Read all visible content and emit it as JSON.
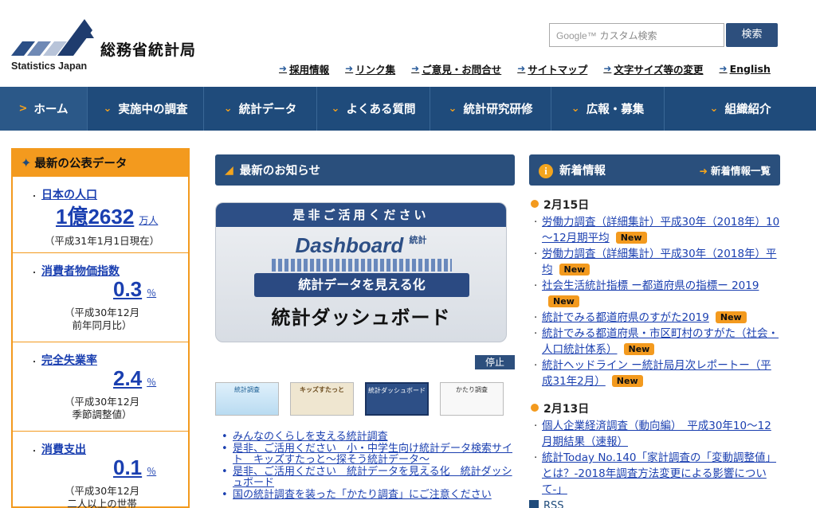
{
  "header": {
    "logo_en": "Statistics Japan",
    "site_title": "総務省統計局",
    "search": {
      "google": "Google™",
      "placeholder": "カスタム検索",
      "button": "検索"
    },
    "utility_links": [
      "採用情報",
      "リンク集",
      "ご意見・お問合せ",
      "サイトマップ",
      "文字サイズ等の変更",
      "English"
    ]
  },
  "nav": {
    "items": [
      "ホーム",
      "実施中の調査",
      "統計データ",
      "よくある質問",
      "統計研究研修",
      "広報・募集",
      "組織紹介"
    ]
  },
  "left": {
    "title": "最新の公表データ",
    "stats": [
      {
        "name": "日本の人口",
        "value": "1億2632",
        "unit": "万人",
        "note1": "（平成31年1月1日現在）",
        "note2": ""
      },
      {
        "name": "消費者物価指数",
        "value": "0.3",
        "unit": "％",
        "note1": "（平成30年12月",
        "note2": "前年同月比）"
      },
      {
        "name": "完全失業率",
        "value": "2.4",
        "unit": "％",
        "note1": "（平成30年12月",
        "note2": "季節調整値）"
      },
      {
        "name": "消費支出",
        "value": "0.1",
        "unit": "％",
        "note1": "（平成30年12月",
        "note2": "二人以上の世帯"
      }
    ]
  },
  "center": {
    "title": "最新のお知らせ",
    "banner": {
      "top": "是非ご活用ください",
      "logo": "Dashboard",
      "logo_tag": "統計",
      "sub": "統計データを見える化",
      "main": "統計ダッシュボード"
    },
    "stop_button": "停止",
    "thumbs": [
      "統計調査",
      "キッズすたっと",
      "統計ダッシュボード",
      "かたり調査"
    ],
    "news": [
      "みんなのくらしを支える統計調査",
      "是非、ご活用ください　小・中学生向け統計データ検索サイト　キッズすたっと～探そう統計データ～",
      "是非、ご活用ください　統計データを見える化　統計ダッシュボード",
      "国の統計調査を装った「かたり調査」にご注意ください"
    ]
  },
  "right": {
    "title": "新着情報",
    "more": "新着情報一覧",
    "new_label": "New",
    "groups": [
      {
        "date": "2月15日",
        "items": [
          {
            "text": "労働力調査（詳細集計）平成30年（2018年）10～12月期平均",
            "new": true
          },
          {
            "text": "労働力調査（詳細集計）平成30年（2018年）平均",
            "new": true
          },
          {
            "text": "社会生活統計指標 ー都道府県の指標ー 2019",
            "new": true
          },
          {
            "text": "統計でみる都道府県のすがた2019",
            "new": true
          },
          {
            "text": "統計でみる都道府県・市区町村のすがた（社会・人口統計体系）",
            "new": true
          },
          {
            "text": "統計ヘッドライン ー統計局月次レポートー（平成31年2月）",
            "new": true
          }
        ]
      },
      {
        "date": "2月13日",
        "items": [
          {
            "text": "個人企業経済調査（動向編）　平成30年10～12月期結果（速報）",
            "new": false
          },
          {
            "text": "統計Today No.140「家計調査の「変動調整値」とは？-2018年調査方法変更による影響について-」",
            "new": false
          }
        ]
      }
    ],
    "rss": "RSS"
  },
  "colors": {
    "navy": "#1f4b7b",
    "orange": "#f39a1e",
    "link": "#1a3fb0"
  }
}
